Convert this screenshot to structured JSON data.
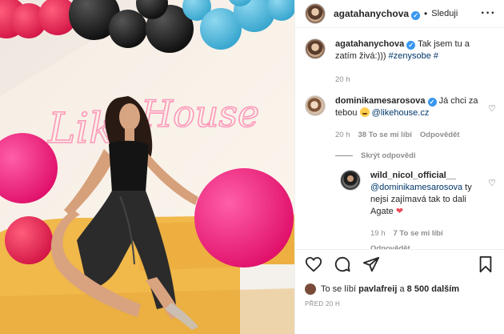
{
  "post": {
    "username": "agatahanychova",
    "follow_label": "Sleduji",
    "more_icon": "more-icon"
  },
  "caption": {
    "username": "agatahanychova",
    "text": "Tak jsem tu a zatím živá:)))",
    "hashtags": "#zenysobe #",
    "time": "20 h"
  },
  "comments": [
    {
      "username": "dominikamesarosova",
      "text": "Já chci za tebou",
      "mention": "@likehouse.cz",
      "time": "20 h",
      "likes": "38 To se mi líbí",
      "reply_label": "Odpovědět",
      "toggle": "Skrýt odpovědi"
    },
    {
      "username": "wild_nicol_official__",
      "mention": "@dominikamesarosova",
      "text": "ty nejsi zajímavá tak to dali Agate",
      "time": "19 h",
      "likes": "7 To se mi líbí",
      "reply_label": "Odpovědět"
    }
  ],
  "footer": {
    "likes_prefix": "To se líbí",
    "likes_user": "pavlafreij",
    "likes_conj": "a",
    "likes_others": "8 500 dalším",
    "date": "PŘED 20 H"
  },
  "photo": {
    "neon_text": "Like House"
  },
  "colors": {
    "link": "#00376b",
    "muted": "#8e8e8e",
    "verified": "#3897f0",
    "heart": "#ed4956",
    "neon": "#ff4f8b",
    "balloon_pink": "#f0197a",
    "balloon_blue": "#4bb8dc"
  }
}
